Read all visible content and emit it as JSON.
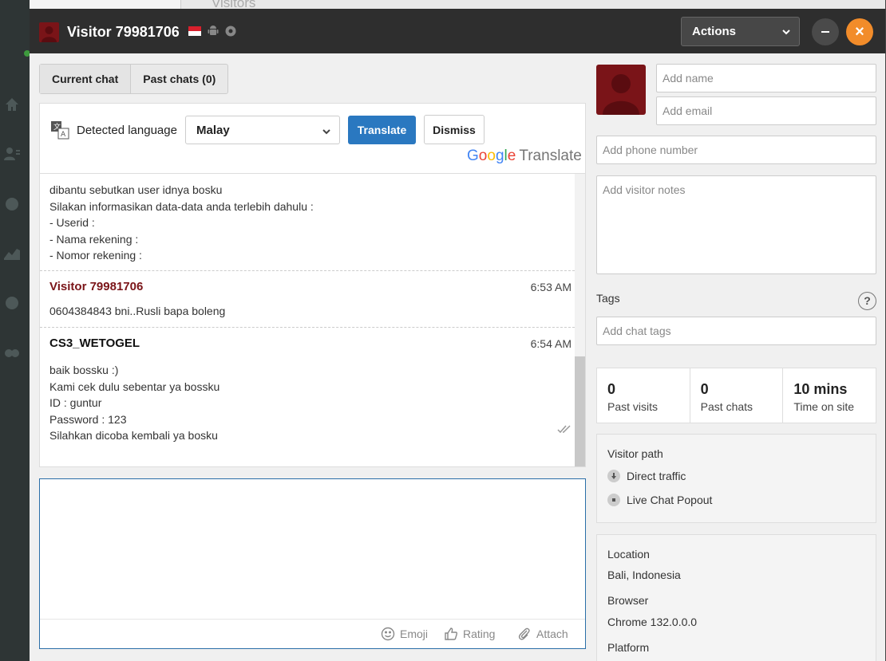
{
  "background": {
    "page_title": "Visitors"
  },
  "window": {
    "title": "Visitor 79981706",
    "actions_label": "Actions",
    "close_glyph": "×"
  },
  "tabs": [
    {
      "label": "Current chat"
    },
    {
      "label": "Past chats (0)"
    }
  ],
  "translate": {
    "detected_label": "Detected language",
    "language": "Malay",
    "translate_label": "Translate",
    "dismiss_label": "Dismiss",
    "logo_g": "G",
    "logo_o1": "o",
    "logo_o2": "o",
    "logo_g2": "g",
    "logo_l": "l",
    "logo_e": "e",
    "logo_word": "Translate"
  },
  "messages": {
    "m0": {
      "lines": [
        "dibantu sebutkan user idnya bosku",
        "Silakan informasikan data-data anda terlebih dahulu :",
        "- Userid :",
        "- Nama rekening :",
        "- Nomor rekening :"
      ]
    },
    "m1": {
      "sender": "Visitor 79981706",
      "time": "6:53 AM",
      "text": "0604384843 bni..Rusli bapa boleng"
    },
    "m2": {
      "sender": "CS3_WETOGEL",
      "time": "6:54 AM",
      "lines": [
        "baik bossku :)",
        "Kami cek dulu sebentar ya bossku",
        "ID : guntur",
        "Password : 123",
        "Silahkan dicoba kembali ya bosku"
      ]
    }
  },
  "composer": {
    "emoji_label": "Emoji",
    "rating_label": "Rating",
    "attach_label": "Attach"
  },
  "visitor": {
    "name_placeholder": "Add name",
    "email_placeholder": "Add email",
    "phone_placeholder": "Add phone number",
    "notes_placeholder": "Add visitor notes",
    "tags_label": "Tags",
    "tags_placeholder": "Add chat tags",
    "help_glyph": "?"
  },
  "stats": [
    {
      "value": "0",
      "label": "Past visits"
    },
    {
      "value": "0",
      "label": "Past chats"
    },
    {
      "value": "10 mins",
      "label": "Time on site"
    }
  ],
  "visitor_path": {
    "title": "Visitor path",
    "items": [
      "Direct traffic",
      "Live Chat Popout"
    ]
  },
  "info": {
    "location_label": "Location",
    "location": "Bali, Indonesia",
    "browser_label": "Browser",
    "browser": "Chrome 132.0.0.0",
    "platform_label": "Platform"
  }
}
